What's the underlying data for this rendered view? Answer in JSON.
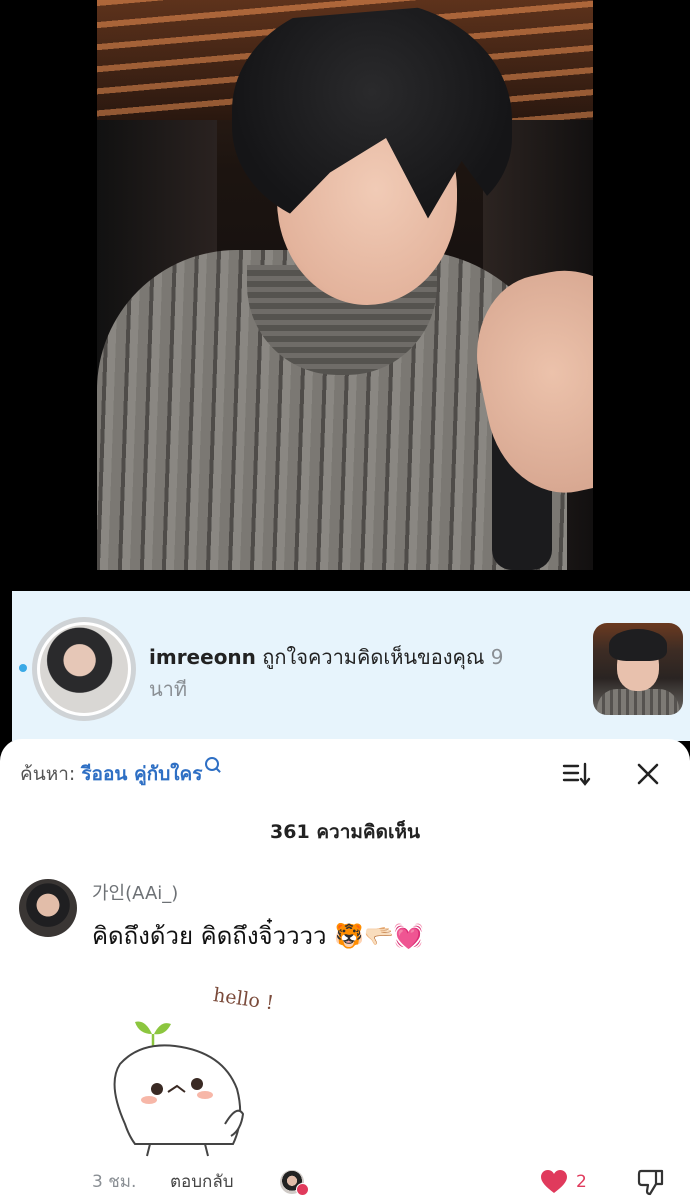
{
  "notification": {
    "username": "imreeonn",
    "action": "ถูกใจความคิดเห็นของคุณ",
    "time_value": "9",
    "time_unit": "นาที"
  },
  "comments_sheet": {
    "search_prefix": "ค้นหา:",
    "search_query": "รีออน คู่กับใคร",
    "comment_count_label": "361 ความคิดเห็น"
  },
  "comment": {
    "author": "가인(AAi_)",
    "text": "คิดถึงด้วย คิดถึงจิ๋วววว 🐯🫳🏻💓",
    "sticker_text": "hello !",
    "time": "3 ชม.",
    "reply_label": "ตอบกลับ",
    "likes": "2"
  },
  "colors": {
    "notification_bg": "#e7f4fc",
    "link_blue": "#2e6fc4",
    "like_red": "#e03a5c"
  }
}
